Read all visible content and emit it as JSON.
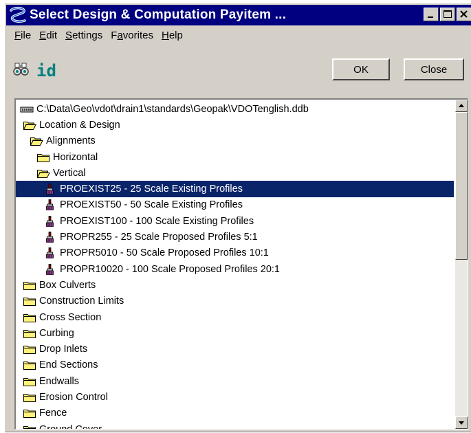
{
  "window": {
    "title": "Select Design & Computation Payitem ..."
  },
  "menu": {
    "items": [
      "File",
      "Edit",
      "Settings",
      "Favorites",
      "Help"
    ],
    "accelerators": [
      "F",
      "E",
      "S",
      "a",
      "H"
    ]
  },
  "toolbar": {
    "find_icon": "binoculars-icon",
    "id_label": "id"
  },
  "buttons": {
    "ok": "OK",
    "close": "Close"
  },
  "tree": {
    "rows": [
      {
        "label": "C:\\Data\\Geo\\vdot\\drain1\\standards\\Geopak\\VDOTenglish.ddb",
        "icon": "drive-icon",
        "level": 0,
        "selected": false
      },
      {
        "label": "Location & Design",
        "icon": "folder-open-icon",
        "level": 1,
        "selected": false
      },
      {
        "label": "Alignments",
        "icon": "folder-open-icon",
        "level": 2,
        "selected": false
      },
      {
        "label": "Horizontal",
        "icon": "folder-icon",
        "level": 3,
        "selected": false
      },
      {
        "label": "Vertical",
        "icon": "folder-open-icon",
        "level": 3,
        "selected": false
      },
      {
        "label": "PROEXIST25 - 25 Scale Existing Profiles",
        "icon": "paintbrush-icon",
        "level": 4,
        "selected": true
      },
      {
        "label": "PROEXIST50 - 50 Scale Existing Profiles",
        "icon": "paintbrush-icon",
        "level": 4,
        "selected": false
      },
      {
        "label": "PROEXIST100 - 100 Scale Existing Profiles",
        "icon": "paintbrush-icon",
        "level": 4,
        "selected": false
      },
      {
        "label": "PROPR255 - 25 Scale Proposed Profiles 5:1",
        "icon": "paintbrush-icon",
        "level": 4,
        "selected": false
      },
      {
        "label": "PROPR5010 - 50 Scale Proposed Profiles 10:1",
        "icon": "paintbrush-icon",
        "level": 4,
        "selected": false
      },
      {
        "label": "PROPR10020 - 100 Scale Proposed Profiles 20:1",
        "icon": "paintbrush-icon",
        "level": 4,
        "selected": false
      },
      {
        "label": "Box Culverts",
        "icon": "folder-icon",
        "level": 1,
        "selected": false
      },
      {
        "label": "Construction Limits",
        "icon": "folder-icon",
        "level": 1,
        "selected": false
      },
      {
        "label": "Cross Section",
        "icon": "folder-icon",
        "level": 1,
        "selected": false
      },
      {
        "label": "Curbing",
        "icon": "folder-icon",
        "level": 1,
        "selected": false
      },
      {
        "label": "Drop Inlets",
        "icon": "folder-icon",
        "level": 1,
        "selected": false
      },
      {
        "label": "End Sections",
        "icon": "folder-icon",
        "level": 1,
        "selected": false
      },
      {
        "label": "Endwalls",
        "icon": "folder-icon",
        "level": 1,
        "selected": false
      },
      {
        "label": "Erosion Control",
        "icon": "folder-icon",
        "level": 1,
        "selected": false
      },
      {
        "label": "Fence",
        "icon": "folder-icon",
        "level": 1,
        "selected": false
      },
      {
        "label": "Ground Cover",
        "icon": "folder-icon",
        "level": 1,
        "selected": false
      }
    ]
  },
  "colors": {
    "title_bar": "#000080",
    "selection": "#0a246a",
    "window_face": "#d4d0c8",
    "folder": "#fff27a",
    "id_icon": "#008080"
  }
}
